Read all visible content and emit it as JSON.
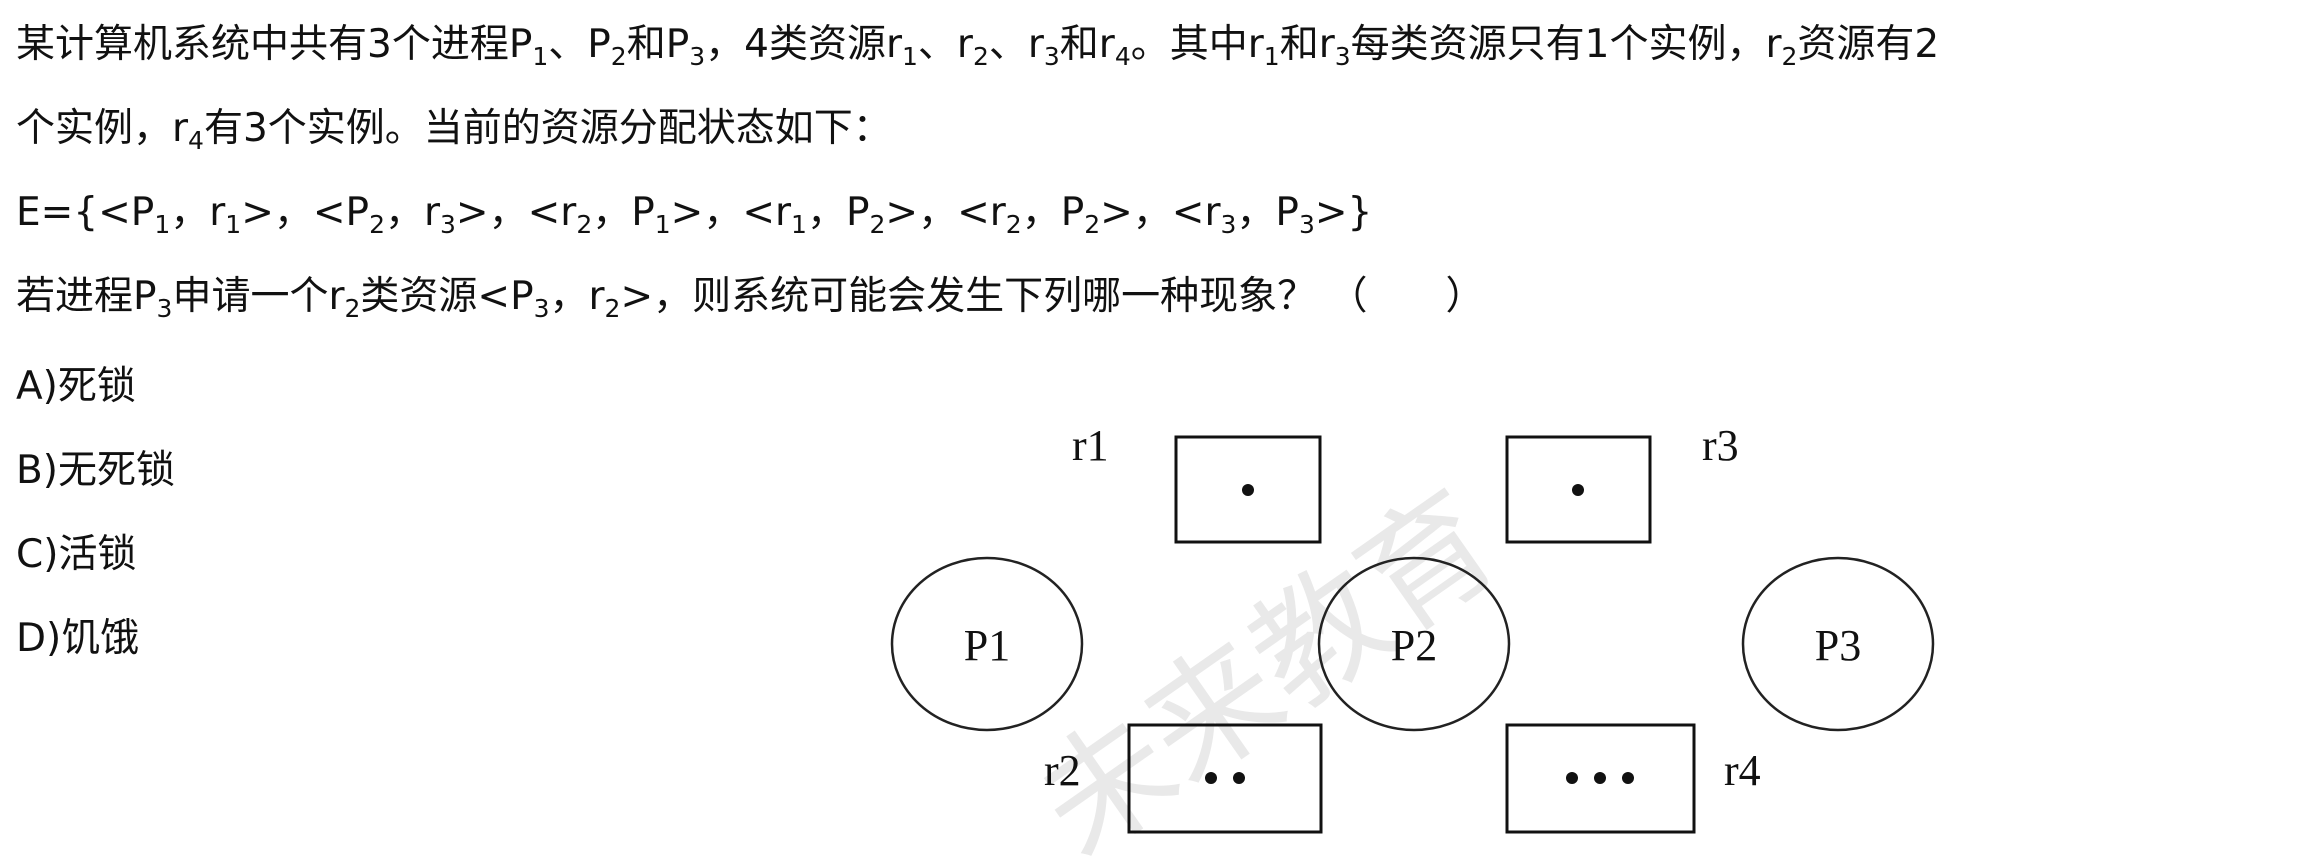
{
  "question": {
    "lines": [
      [
        {
          "t": "某计算机系统中共有3个进程P"
        },
        {
          "s": "1"
        },
        {
          "t": "、P"
        },
        {
          "s": "2"
        },
        {
          "t": "和P"
        },
        {
          "s": "3"
        },
        {
          "t": "，4类资源r"
        },
        {
          "s": "1"
        },
        {
          "t": "、r"
        },
        {
          "s": "2"
        },
        {
          "t": "、r"
        },
        {
          "s": "3"
        },
        {
          "t": "和r"
        },
        {
          "s": "4"
        },
        {
          "t": "。其中r"
        },
        {
          "s": "1"
        },
        {
          "t": "和r"
        },
        {
          "s": "3"
        },
        {
          "t": "每类资源只有1个实例，r"
        },
        {
          "s": "2"
        },
        {
          "t": "资源有2"
        }
      ],
      [
        {
          "t": "个实例，r"
        },
        {
          "s": "4"
        },
        {
          "t": "有3个实例。当前的资源分配状态如下："
        }
      ],
      [
        {
          "t": "E={<P"
        },
        {
          "s": "1"
        },
        {
          "t": "，r"
        },
        {
          "s": "1"
        },
        {
          "t": ">，<P"
        },
        {
          "s": "2"
        },
        {
          "t": "，r"
        },
        {
          "s": "3"
        },
        {
          "t": ">，<r"
        },
        {
          "s": "2"
        },
        {
          "t": "，P"
        },
        {
          "s": "1"
        },
        {
          "t": ">，<r"
        },
        {
          "s": "1"
        },
        {
          "t": "，P"
        },
        {
          "s": "2"
        },
        {
          "t": ">，<r"
        },
        {
          "s": "2"
        },
        {
          "t": "，P"
        },
        {
          "s": "2"
        },
        {
          "t": ">，<r"
        },
        {
          "s": "3"
        },
        {
          "t": "，P"
        },
        {
          "s": "3"
        },
        {
          "t": ">}"
        }
      ],
      [
        {
          "t": "若进程P"
        },
        {
          "s": "3"
        },
        {
          "t": "申请一个r"
        },
        {
          "s": "2"
        },
        {
          "t": "类资源<P"
        },
        {
          "s": "3"
        },
        {
          "t": "，r"
        },
        {
          "s": "2"
        },
        {
          "t": ">，则系统可能会发生下列哪一种现象？ （　　）"
        }
      ]
    ]
  },
  "options": [
    "A)死锁",
    "B)无死锁",
    "C)活锁",
    "D)饥饿"
  ],
  "diagram": {
    "processes": [
      "P1",
      "P2",
      "P3"
    ],
    "resources": [
      {
        "label": "r1",
        "instances": 1
      },
      {
        "label": "r3",
        "instances": 1
      },
      {
        "label": "r2",
        "instances": 2
      },
      {
        "label": "r4",
        "instances": 3
      }
    ],
    "watermark": "未来教育"
  }
}
